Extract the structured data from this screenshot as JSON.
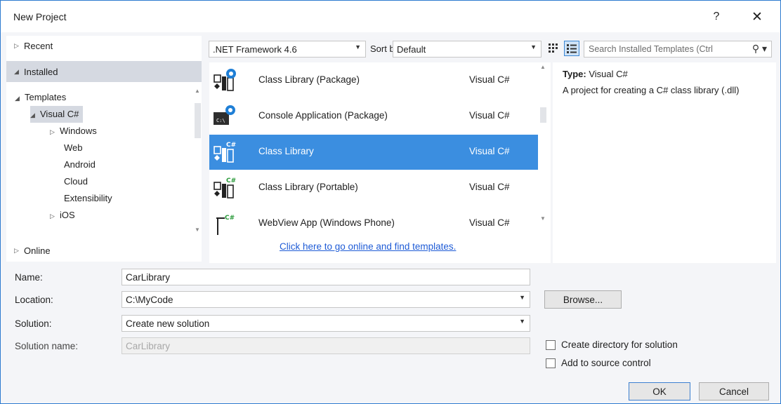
{
  "window": {
    "title": "New Project",
    "help": "?",
    "close": "✕"
  },
  "nav": {
    "recent": "Recent",
    "installed": "Installed",
    "online": "Online",
    "tree": [
      {
        "label": "Templates",
        "indent": 0,
        "arrow": "◢",
        "selected": false
      },
      {
        "label": "Visual C#",
        "indent": 1,
        "arrow": "◢",
        "selected": true
      },
      {
        "label": "Windows",
        "indent": 2,
        "arrow": "▷",
        "selected": false
      },
      {
        "label": "Web",
        "indent": 3,
        "arrow": "",
        "selected": false
      },
      {
        "label": "Android",
        "indent": 3,
        "arrow": "",
        "selected": false
      },
      {
        "label": "Cloud",
        "indent": 3,
        "arrow": "",
        "selected": false
      },
      {
        "label": "Extensibility",
        "indent": 3,
        "arrow": "",
        "selected": false
      },
      {
        "label": "iOS",
        "indent": 2,
        "arrow": "▷",
        "selected": false
      }
    ]
  },
  "toolbar": {
    "framework": ".NET Framework 4.6",
    "sort_label": "Sort by:",
    "sort_value": "Default",
    "search_placeholder": "Search Installed Templates (Ctrl"
  },
  "templates": [
    {
      "name": "Class Library (Package)",
      "lang": "Visual C#",
      "icon": "class-library-package-icon",
      "selected": false
    },
    {
      "name": "Console Application (Package)",
      "lang": "Visual C#",
      "icon": "console-app-icon",
      "selected": false
    },
    {
      "name": "Class Library",
      "lang": "Visual C#",
      "icon": "class-library-icon",
      "selected": true
    },
    {
      "name": "Class Library (Portable)",
      "lang": "Visual C#",
      "icon": "class-library-portable-icon",
      "selected": false
    },
    {
      "name": "WebView App (Windows Phone)",
      "lang": "Visual C#",
      "icon": "webview-app-icon",
      "selected": false
    }
  ],
  "online_link": "Click here to go online and find templates.",
  "info": {
    "type_label": "Type:",
    "type_value": "Visual C#",
    "description": "A project for creating a C# class library (.dll)"
  },
  "form": {
    "name_label": "Name:",
    "name_value": "CarLibrary",
    "location_label": "Location:",
    "location_value": "C:\\MyCode",
    "solution_label": "Solution:",
    "solution_value": "Create new solution",
    "solution_name_label": "Solution name:",
    "solution_name_value": "CarLibrary",
    "browse": "Browse...",
    "create_dir": "Create directory for solution",
    "source_control": "Add to source control",
    "ok": "OK",
    "cancel": "Cancel"
  },
  "colors": {
    "selection": "#3b8ee0",
    "nav_selection": "#d5d9e1",
    "link": "#1e5bd6",
    "border_accent": "#2d7bd0"
  }
}
